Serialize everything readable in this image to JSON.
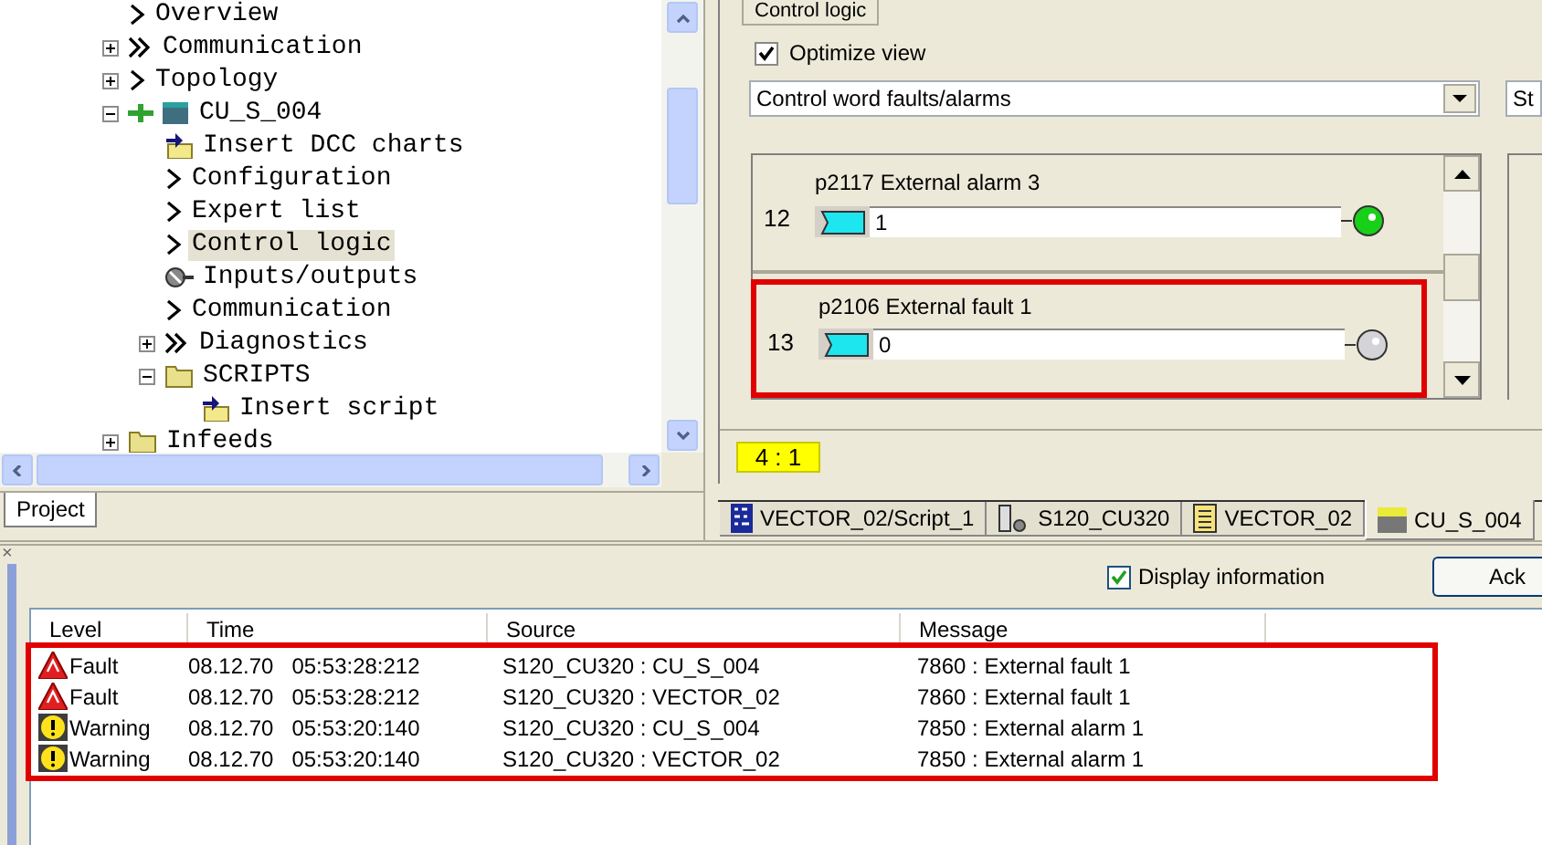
{
  "project_tree": {
    "items": [
      {
        "label": "Overview",
        "kind": "page",
        "selected": false
      },
      {
        "label": "Communication",
        "kind": "group",
        "expanded": false,
        "selected": false
      },
      {
        "label": "Topology",
        "kind": "page",
        "expanded": false,
        "selected": false
      },
      {
        "label": "CU_S_004",
        "kind": "device",
        "expanded": true,
        "selected": false,
        "children": [
          {
            "label": "Insert DCC charts",
            "kind": "insert",
            "selected": false
          },
          {
            "label": "Configuration",
            "kind": "page",
            "selected": false
          },
          {
            "label": "Expert list",
            "kind": "page",
            "selected": false
          },
          {
            "label": "Control logic",
            "kind": "page",
            "selected": true
          },
          {
            "label": "Inputs/outputs",
            "kind": "io",
            "selected": false
          },
          {
            "label": "Communication",
            "kind": "page",
            "selected": false
          },
          {
            "label": "Diagnostics",
            "kind": "group",
            "expanded": false,
            "selected": false
          },
          {
            "label": "SCRIPTS",
            "kind": "folder",
            "expanded": true,
            "selected": false,
            "children": [
              {
                "label": "Insert script",
                "kind": "insert",
                "selected": false
              }
            ]
          }
        ]
      },
      {
        "label": "Infeeds",
        "kind": "folder",
        "expanded": false,
        "selected": false
      }
    ]
  },
  "left_tabs": [
    {
      "label": "Project",
      "selected": true
    }
  ],
  "control_logic": {
    "tab": "Control logic",
    "optimize_view": {
      "label": "Optimize view",
      "checked": true
    },
    "dropdown": {
      "value": "Control word faults/alarms"
    },
    "side_field": {
      "value": "St"
    },
    "rows": [
      {
        "number": "12",
        "title": "p2117 External alarm 3",
        "value": "1",
        "on": true,
        "highlighted": false
      },
      {
        "number": "13",
        "title": "p2106 External fault 1",
        "value": "0",
        "on": false,
        "highlighted": true
      }
    ],
    "zoom": "4 : 1"
  },
  "editor_tabs": [
    {
      "label": "VECTOR_02/Script_1",
      "kind": "script",
      "selected": false
    },
    {
      "label": "S120_CU320",
      "kind": "device",
      "selected": false
    },
    {
      "label": "VECTOR_02",
      "kind": "list",
      "selected": false
    },
    {
      "label": "CU_S_004",
      "kind": "cu",
      "selected": true
    }
  ],
  "alarms": {
    "close": "×",
    "display_information": {
      "label": "Display information",
      "checked": true
    },
    "acknowledge_button": "Ack",
    "columns": [
      "Level",
      "Time",
      "Source",
      "Message"
    ],
    "rows": [
      {
        "kind": "fault",
        "level": "Fault",
        "time": "08.12.70   05:53:28:212",
        "source": "S120_CU320 : CU_S_004",
        "message": "7860 : External fault 1"
      },
      {
        "kind": "fault",
        "level": "Fault",
        "time": "08.12.70   05:53:28:212",
        "source": "S120_CU320 : VECTOR_02",
        "message": "7860 : External fault 1"
      },
      {
        "kind": "warning",
        "level": "Warning",
        "time": "08.12.70   05:53:20:140",
        "source": "S120_CU320 : CU_S_004",
        "message": "7850 : External alarm 1"
      },
      {
        "kind": "warning",
        "level": "Warning",
        "time": "08.12.70   05:53:20:140",
        "source": "S120_CU320 : VECTOR_02",
        "message": "7850 : External alarm 1"
      }
    ],
    "highlighted": true
  }
}
